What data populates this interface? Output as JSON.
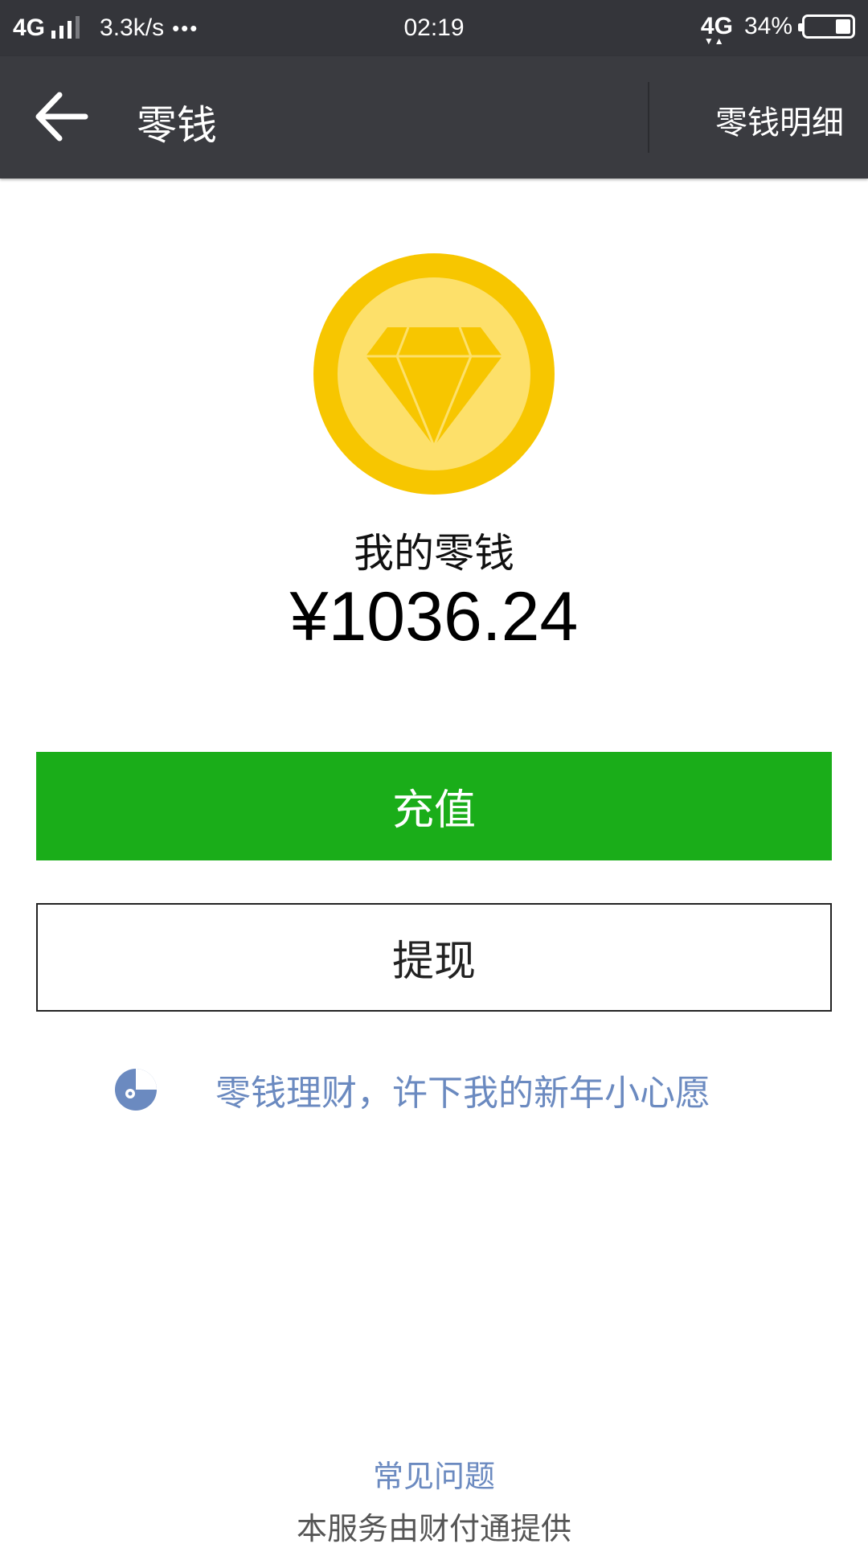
{
  "status_bar": {
    "network": "4G",
    "speed": "3.3k/s",
    "dots": "•••",
    "time": "02:19",
    "network_right": "4G",
    "network_arrows": "▼▲",
    "battery_percent": "34%",
    "battery_level": 0.34
  },
  "nav": {
    "title": "零钱",
    "detail_label": "零钱明细"
  },
  "wallet": {
    "label": "我的零钱",
    "amount": "¥1036.24"
  },
  "actions": {
    "recharge_label": "充值",
    "withdraw_label": "提现"
  },
  "promo": {
    "text": "零钱理财，许下我的新年小心愿"
  },
  "footer": {
    "faq_label": "常见问题",
    "provider_text": "本服务由财付通提供"
  },
  "colors": {
    "primary_green": "#1aad19",
    "coin_outer": "#f7c600",
    "coin_inner": "#fde06a",
    "link_blue": "#6b8ac0"
  },
  "icons": {
    "back": "arrow-left-icon",
    "coin": "diamond-coin-icon",
    "promo": "lct-logo-icon"
  }
}
